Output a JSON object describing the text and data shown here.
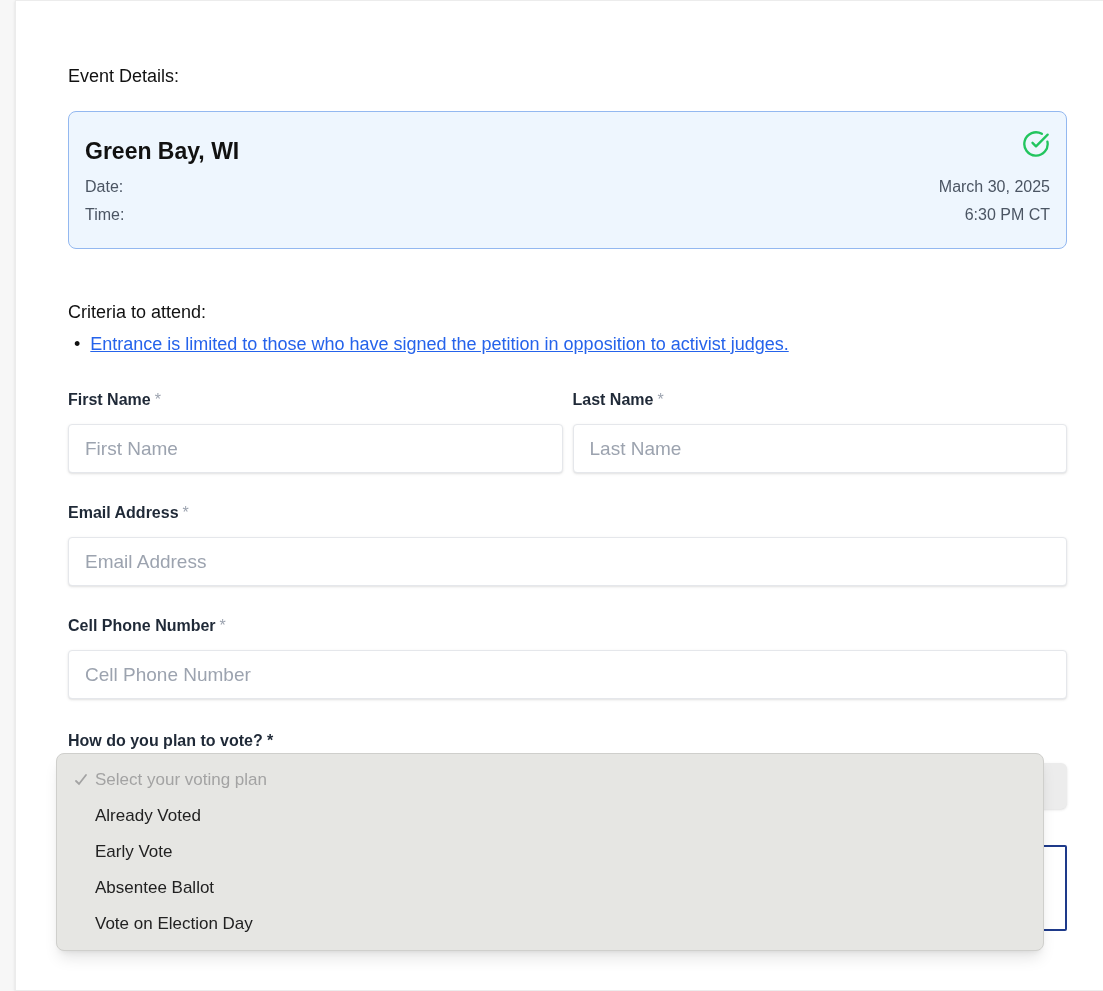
{
  "section_title": "Event Details:",
  "event": {
    "title": "Green Bay, WI",
    "confirmed": true,
    "rows": [
      {
        "label": "Date:",
        "value": "March 30, 2025"
      },
      {
        "label": "Time:",
        "value": "6:30 PM CT"
      }
    ]
  },
  "criteria": {
    "title": "Criteria to attend:",
    "items": [
      {
        "bullet": "•",
        "text": "Entrance is limited to those who have signed the petition in opposition to activist judges."
      }
    ]
  },
  "field_rows": [
    [
      {
        "label": "First Name",
        "required_mark": "*",
        "placeholder": "First Name"
      },
      {
        "label": "Last Name",
        "required_mark": "*",
        "placeholder": "Last Name"
      }
    ],
    [
      {
        "label": "Email Address",
        "required_mark": "*",
        "placeholder": "Email Address"
      }
    ],
    [
      {
        "label": "Cell Phone Number",
        "required_mark": "*",
        "placeholder": "Cell Phone Number"
      }
    ]
  ],
  "vote": {
    "label": "How do you plan to vote? *",
    "options": [
      {
        "text": "Select your voting plan",
        "selected": true,
        "disabled": true
      },
      {
        "text": "Already Voted",
        "selected": false,
        "disabled": false
      },
      {
        "text": "Early Vote",
        "selected": false,
        "disabled": false
      },
      {
        "text": "Absentee Ballot",
        "selected": false,
        "disabled": false
      },
      {
        "text": "Vote on Election Day",
        "selected": false,
        "disabled": false
      }
    ]
  }
}
